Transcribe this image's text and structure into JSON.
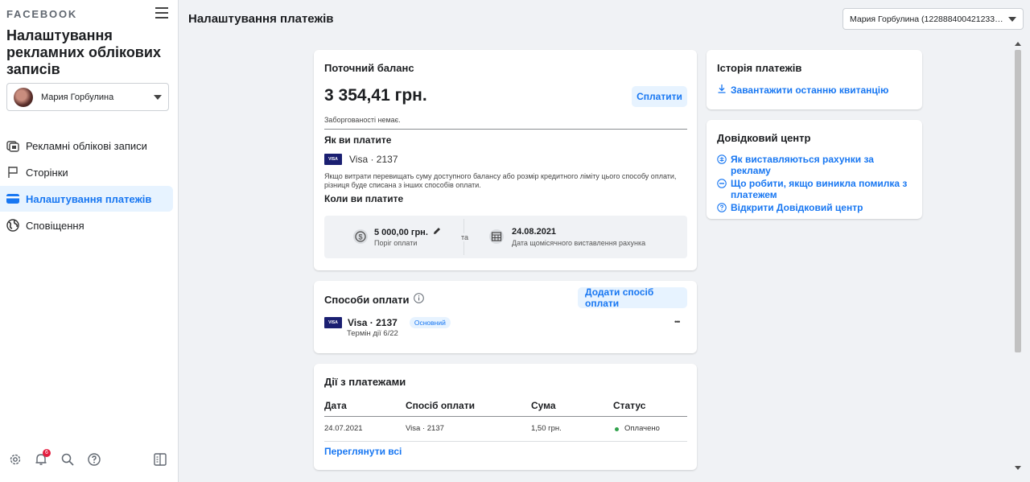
{
  "sidebar": {
    "brand": "FACEBOOK",
    "title": "Налаштування рекламних облікових записів",
    "account_name": "Мария Горбулина",
    "nav": [
      {
        "label": "Рекламні облікові записи",
        "icon": "ad-accounts-icon"
      },
      {
        "label": "Сторінки",
        "icon": "flag-icon"
      },
      {
        "label": "Налаштування платежів",
        "icon": "credit-card-icon"
      },
      {
        "label": "Сповіщення",
        "icon": "globe-icon"
      }
    ],
    "notification_count": "6"
  },
  "header": {
    "title": "Налаштування платежів",
    "account_select": "Мария Горбулина (122888400421233…"
  },
  "balance": {
    "title": "Поточний баланс",
    "amount": "3 354,41 грн.",
    "pay_button": "Сплатити",
    "debt_note": "Заборгованості немає.",
    "how_you_pay_title": "Як ви платите",
    "card_label": "Visa · 2137",
    "card_brand": "VISA",
    "note": "Якщо витрати перевищать суму доступного балансу або розмір кредитного ліміту цього способу оплати, різниця буде списана з інших способів оплати.",
    "when_you_pay_title": "Коли ви платите",
    "threshold_value": "5 000,00 грн.",
    "threshold_label": "Поріг оплати",
    "and_label": "та",
    "billing_date": "24.08.2021",
    "billing_date_label": "Дата щомісячного виставлення рахунка"
  },
  "methods": {
    "title": "Способи оплати",
    "add_button": "Додати спосіб оплати",
    "card_label": "Visa · 2137",
    "card_brand": "VISA",
    "primary_badge": "Основний",
    "expiry": "Термін дії 6/22",
    "more": "•••"
  },
  "activity": {
    "title": "Дії з платежами",
    "columns": [
      "Дата",
      "Спосіб оплати",
      "Сума",
      "Статус"
    ],
    "rows": [
      {
        "date": "24.07.2021",
        "method": "Visa · 2137",
        "amount": "1,50 грн.",
        "status": "Оплачено"
      }
    ],
    "view_all": "Переглянути всі",
    "status_color": "#31a24c"
  },
  "history": {
    "title": "Історія платежів",
    "download_link": "Завантажити останню квитанцію"
  },
  "help": {
    "title": "Довідковий центр",
    "links": [
      "Як виставляються рахунки за рекламу",
      "Що робити, якщо виникла помилка з платежем",
      "Відкрити Довідковий центр"
    ]
  },
  "colors": {
    "accent": "#1877f2",
    "accent_bg": "#e7f3ff",
    "page_bg": "#f0f2f5"
  }
}
